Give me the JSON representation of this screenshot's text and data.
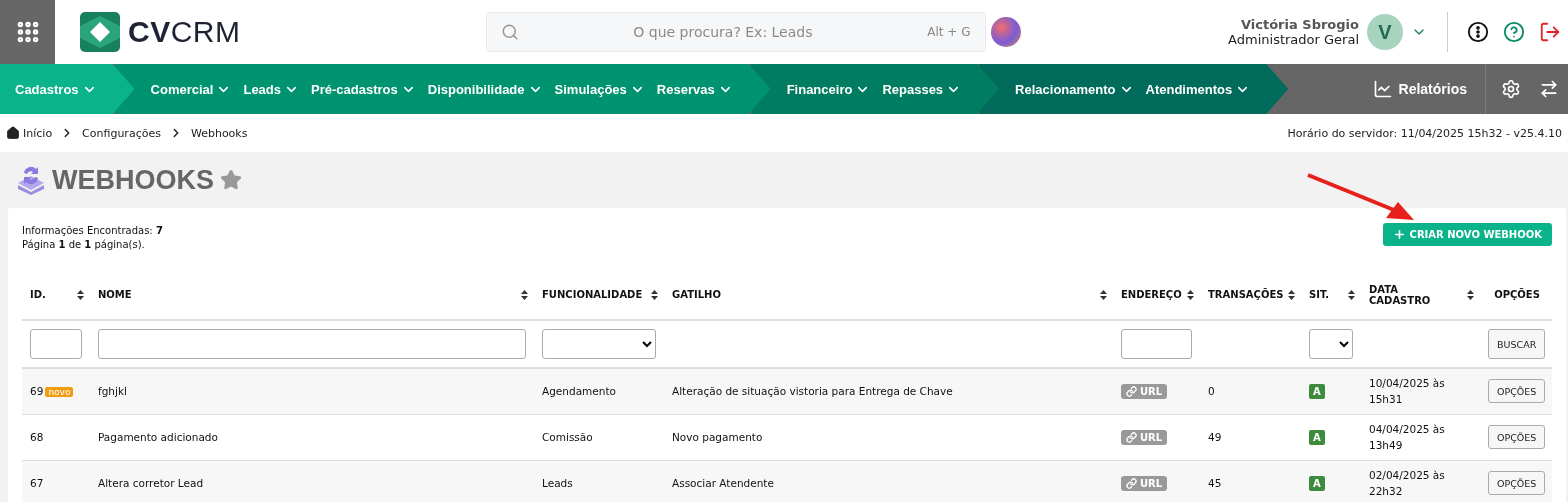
{
  "header": {
    "logo": "**CV**CRM",
    "search": {
      "placeholder": "O que procura? Ex: Leads",
      "shortcut": "Alt + G"
    },
    "user": {
      "name": "Victória Sbrogio",
      "role": "Administrador Geral",
      "initial": "V"
    }
  },
  "nav": {
    "groups": [
      {
        "color": "#0bb38a",
        "items": [
          "Cadastros"
        ]
      },
      {
        "color": "#00936f",
        "items": [
          "Comercial",
          "Leads",
          "Pré-cadastros",
          "Disponibilidade",
          "Simulações",
          "Reservas"
        ]
      },
      {
        "color": "#007d61",
        "items": [
          "Financeiro",
          "Repasses"
        ]
      },
      {
        "color": "#006a5b",
        "items": [
          "Relacionamento",
          "Atendimentos"
        ]
      }
    ],
    "reports": "Relatórios"
  },
  "breadcrumb": [
    "Início",
    "Configurações",
    "Webhooks"
  ],
  "server_time": "Horário do servidor: 11/04/2025 15h32 - v25.4.10",
  "page": {
    "title": "WEBHOOKS",
    "favorite": false,
    "summary": [
      "Informações Encontradas: **7**",
      "Página **1** de **1** página(s)."
    ],
    "create_button": "CRIAR NOVO WEBHOOK"
  },
  "table": {
    "columns": [
      {
        "label": "ID.",
        "sortable": true,
        "filter": {
          "kind": "text"
        }
      },
      {
        "label": "NOME",
        "sortable": true,
        "filter": {
          "kind": "text"
        }
      },
      {
        "label": "FUNCIONALIDADE",
        "sortable": true,
        "filter": {
          "kind": "select"
        }
      },
      {
        "label": "GATILHO",
        "sortable": true
      },
      {
        "label": "ENDEREÇO",
        "sortable": true,
        "filter": {
          "kind": "text"
        }
      },
      {
        "label": "TRANSAÇÕES",
        "sortable": true
      },
      {
        "label": "SIT.",
        "sortable": true,
        "filter": {
          "kind": "select"
        }
      },
      {
        "label": "DATA CADASTRO",
        "sortable": true
      },
      {
        "label": "OPÇÕES",
        "sortable": false,
        "filter": {
          "kind": "button",
          "label": "BUSCAR"
        }
      }
    ],
    "rows": [
      {
        "id": "69",
        "badge": "novo",
        "name": "fghjkl",
        "functionality": "Agendamento",
        "trigger": "Alteração de situação vistoria para Entrega de Chave",
        "address": "URL",
        "transactions": "0",
        "status": "A",
        "date": "10/04/2025 às 15h31",
        "options": "OPÇÕES"
      },
      {
        "id": "68",
        "name": "Pagamento adicionado",
        "functionality": "Comissão",
        "trigger": "Novo pagamento",
        "address": "URL",
        "transactions": "49",
        "status": "A",
        "date": "04/04/2025 às 13h49",
        "options": "OPÇÕES"
      },
      {
        "id": "67",
        "name": "Altera corretor Lead",
        "functionality": "Leads",
        "trigger": "Associar Atendente",
        "address": "URL",
        "transactions": "45",
        "status": "A",
        "date": "02/04/2025 às 22h32",
        "options": "OPÇÕES"
      }
    ]
  }
}
